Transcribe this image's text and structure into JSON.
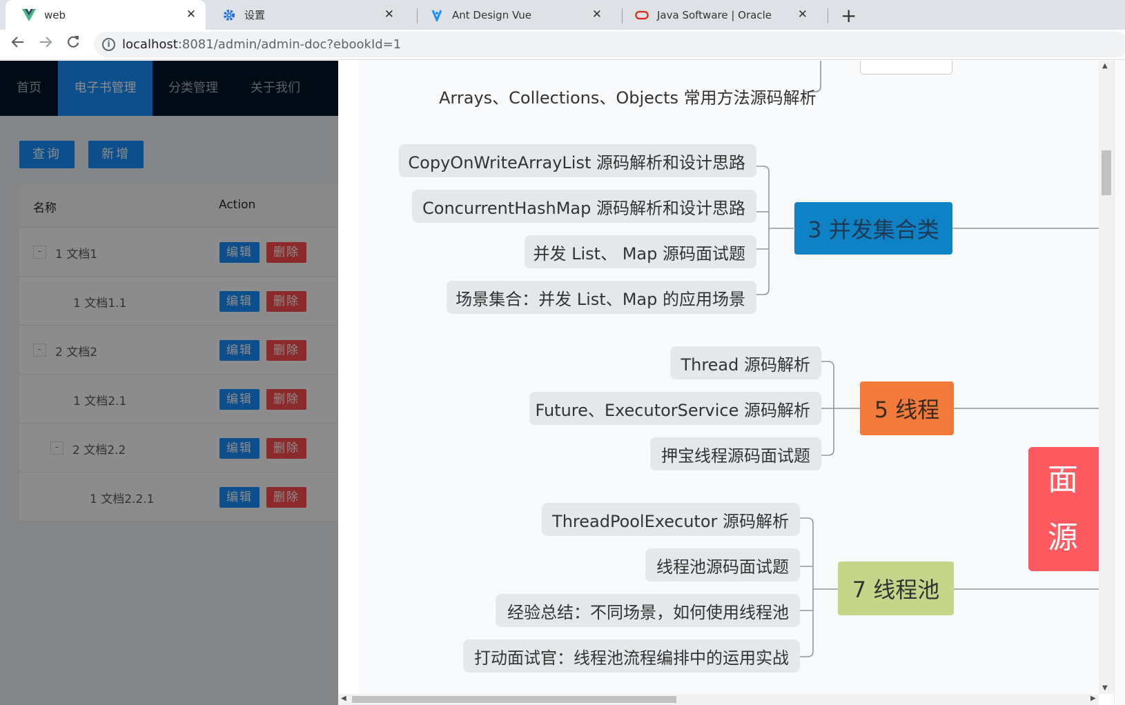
{
  "browser": {
    "tabs": [
      {
        "title": "web",
        "icon": "vue-icon"
      },
      {
        "title": "设置",
        "icon": "gear-icon"
      },
      {
        "title": "Ant Design Vue",
        "icon": "ant-design-icon"
      },
      {
        "title": "Java Software | Oracle",
        "icon": "oracle-icon"
      }
    ],
    "new_tab_label": "+",
    "close_label": "✕",
    "url_host": "localhost",
    "url_rest": ":8081/admin/admin-doc?ebookId=1"
  },
  "header": {
    "menu": [
      "首页",
      "电子书管理",
      "分类管理",
      "关于我们"
    ],
    "selected_index": 1
  },
  "toolbar": {
    "query_label": "查询",
    "add_label": "新增"
  },
  "table": {
    "columns": [
      "名称",
      "Action"
    ],
    "edit_label": "编辑",
    "delete_label": "删除",
    "rows": [
      {
        "name": "1 文档1",
        "level": 0,
        "expandable": true,
        "expander": "-"
      },
      {
        "name": "1 文档1.1",
        "level": 1,
        "expandable": false
      },
      {
        "name": "2 文档2",
        "level": 0,
        "expandable": true,
        "expander": "-"
      },
      {
        "name": "1 文档2.1",
        "level": 1,
        "expandable": false
      },
      {
        "name": "2 文档2.2",
        "level": 1,
        "expandable": true,
        "expander": "-"
      },
      {
        "name": "1 文档2.2.1",
        "level": 2,
        "expandable": false
      }
    ]
  },
  "mindmap": {
    "top_item": "Arrays、Collections、Objects 常用方法源码解析",
    "groups": [
      {
        "hub": "3 并发集合类",
        "hub_color": "#0f82c6",
        "hub_text_color": "#1d3a52",
        "children": [
          "CopyOnWriteArrayList 源码解析和设计思路",
          "ConcurrentHashMap 源码解析和设计思路",
          "并发 List、 Map 源码面试题",
          "场景集合：并发 List、Map 的应用场景"
        ]
      },
      {
        "hub": "5 线程",
        "hub_color": "#f27a3a",
        "hub_text_color": "#3a2a1e",
        "children": [
          "Thread 源码解析",
          "Future、ExecutorService 源码解析",
          "押宝线程源码面试题"
        ]
      },
      {
        "hub": "7 线程池",
        "hub_color": "#c5d68a",
        "hub_text_color": "#333333",
        "children": [
          "ThreadPoolExecutor 源码解析",
          "线程池源码面试题",
          "经验总结：不同场景，如何使用线程池",
          "打动面试官：线程池流程编排中的运用实战"
        ]
      }
    ],
    "root_partial_lines": [
      "面",
      "源"
    ],
    "root_color": "#ff5a5f"
  }
}
